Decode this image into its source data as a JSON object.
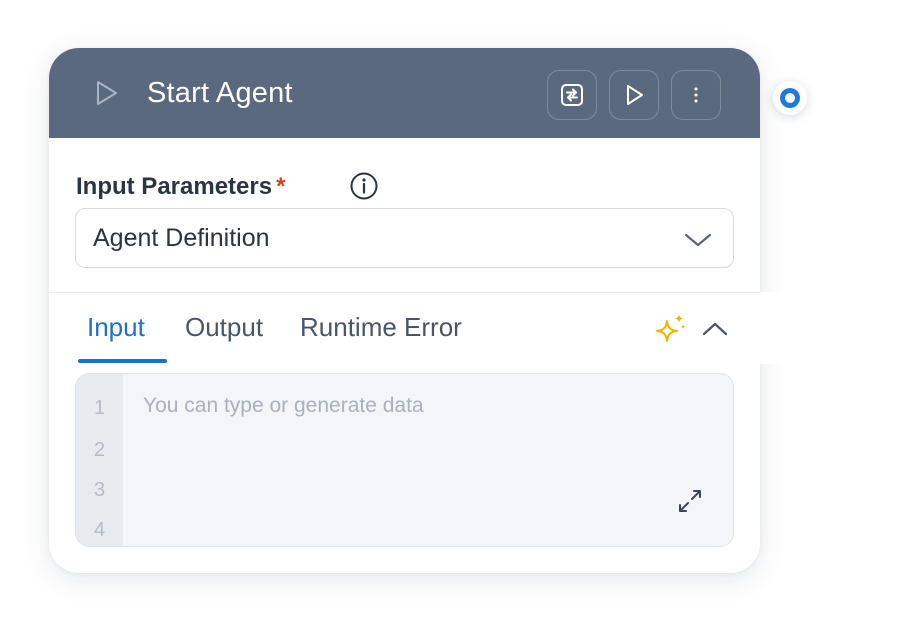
{
  "node": {
    "title": "Start Agent",
    "header_icon": "play-outline-icon",
    "header_buttons": [
      {
        "name": "swap-button",
        "icon": "swap-icon"
      },
      {
        "name": "run-button",
        "icon": "play-icon"
      },
      {
        "name": "more-button",
        "icon": "more-vertical-icon"
      }
    ]
  },
  "input_parameters": {
    "label": "Input Parameters",
    "required_marker": "*",
    "info_icon": "info-icon",
    "selected": "Agent Definition"
  },
  "tabs": [
    {
      "label": "Input",
      "active": true
    },
    {
      "label": "Output",
      "active": false
    },
    {
      "label": "Runtime Error",
      "active": false
    }
  ],
  "editor": {
    "placeholder": "You can type or generate data",
    "line_numbers": [
      "1",
      "2",
      "3",
      "4"
    ]
  },
  "colors": {
    "header_bg": "#5b697e",
    "accent": "#1d6fd1",
    "required": "#d9421b",
    "sparkle": "#f0b400",
    "connector": "#1f78e0"
  }
}
